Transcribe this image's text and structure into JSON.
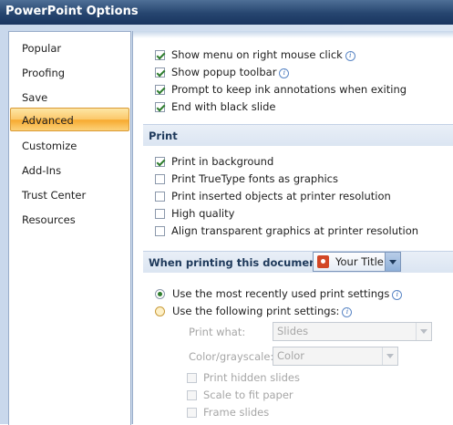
{
  "window": {
    "title": "PowerPoint Options"
  },
  "sidebar": {
    "items": [
      {
        "label": "Popular"
      },
      {
        "label": "Proofing"
      },
      {
        "label": "Save"
      },
      {
        "label": "Advanced",
        "active": true
      },
      {
        "label": "Customize"
      },
      {
        "label": "Add-Ins"
      },
      {
        "label": "Trust Center"
      },
      {
        "label": "Resources"
      }
    ]
  },
  "top_options": [
    {
      "label": "Show menu on right mouse click",
      "checked": true,
      "info": true
    },
    {
      "label": "Show popup toolbar",
      "checked": true,
      "info": true
    },
    {
      "label": "Prompt to keep ink annotations when exiting",
      "checked": true,
      "info": false
    },
    {
      "label": "End with black slide",
      "checked": true,
      "info": false
    }
  ],
  "print_section": {
    "title": "Print",
    "options": [
      {
        "label": "Print in background",
        "checked": true
      },
      {
        "label": "Print TrueType fonts as graphics",
        "checked": false
      },
      {
        "label": "Print inserted objects at printer resolution",
        "checked": false
      },
      {
        "label": "High quality",
        "checked": false
      },
      {
        "label": "Align transparent graphics at printer resolution",
        "checked": false
      }
    ]
  },
  "doc_section": {
    "title": "When printing this document:",
    "document": "Your Title"
  },
  "radios": [
    {
      "label": "Use the most recently used print settings",
      "selected": true
    },
    {
      "label": "Use the following print settings:",
      "selected": false
    }
  ],
  "print_settings": {
    "print_what_label": "Print what:",
    "print_what_value": "Slides",
    "color_label": "Color/grayscale:",
    "color_value": "Color",
    "options": [
      {
        "label": "Print hidden slides"
      },
      {
        "label": "Scale to fit paper"
      },
      {
        "label": "Frame slides"
      }
    ]
  },
  "colors": {
    "accent": "#f7a92e",
    "header": "#1e395b",
    "titlebar": "#26456f"
  },
  "icons": {
    "info": "info-icon",
    "document": "powerpoint-doc-icon"
  }
}
